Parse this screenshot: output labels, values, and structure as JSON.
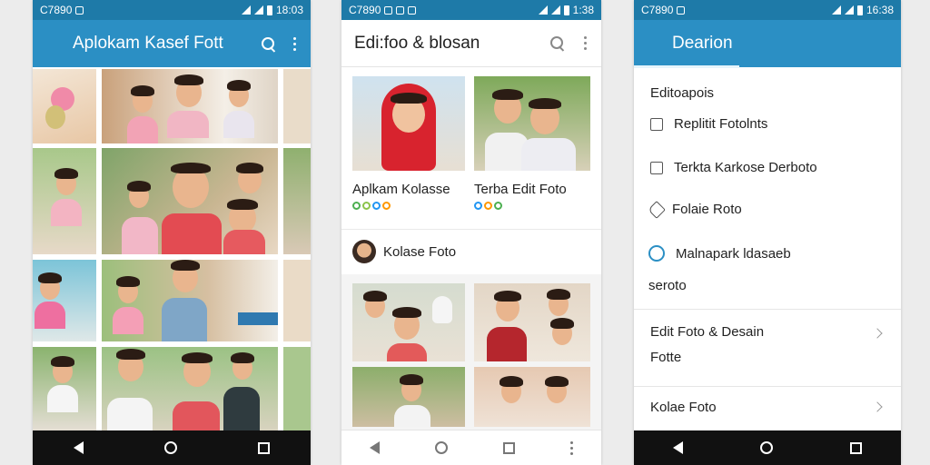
{
  "colors": {
    "accent": "#2b8fc4",
    "accent_dark": "#1e7aa8",
    "navbar": "#111111",
    "text": "#222222"
  },
  "phone1": {
    "status_time_left": "C7890",
    "status_time_right": "18:03",
    "title": "Aplokam Kasef Fott",
    "icons": [
      "search-icon",
      "more-vert-icon"
    ]
  },
  "phone2": {
    "status_time_left": "C7890",
    "status_time_right": "1:38",
    "title": "Edi:foo & blosan",
    "cards": [
      {
        "title": "Aplkam Kolasse",
        "meta": "ᏫᏲᎰᎰ",
        "colors": [
          "#4caf50",
          "#8bc34a",
          "#2196f3",
          "#ff9800"
        ]
      },
      {
        "title": "Terba Edit Foto",
        "meta": "ᏫᏫᏫ",
        "colors": [
          "#2196f3",
          "#ff9800",
          "#4caf50"
        ]
      }
    ],
    "profile_label": "Kolase Foto"
  },
  "phone3": {
    "status_time_left": "C7890",
    "status_time_right": "16:38",
    "title": "Dearion",
    "section_title": "Editoapois",
    "options": [
      {
        "label": "Replitit Fotolnts",
        "type": "checkbox"
      },
      {
        "label": "Terkta Karkose Derboto",
        "type": "checkbox"
      }
    ],
    "folder_label": "Folaie Roto",
    "mail_label_1": "Malnapark ldasaeb",
    "mail_label_2": "seroto",
    "list_items": [
      {
        "label_1": "Edit Foto & Desain",
        "label_2": "Fotte"
      },
      {
        "label_1": "Kolae Foto",
        "label_2": ""
      }
    ]
  }
}
